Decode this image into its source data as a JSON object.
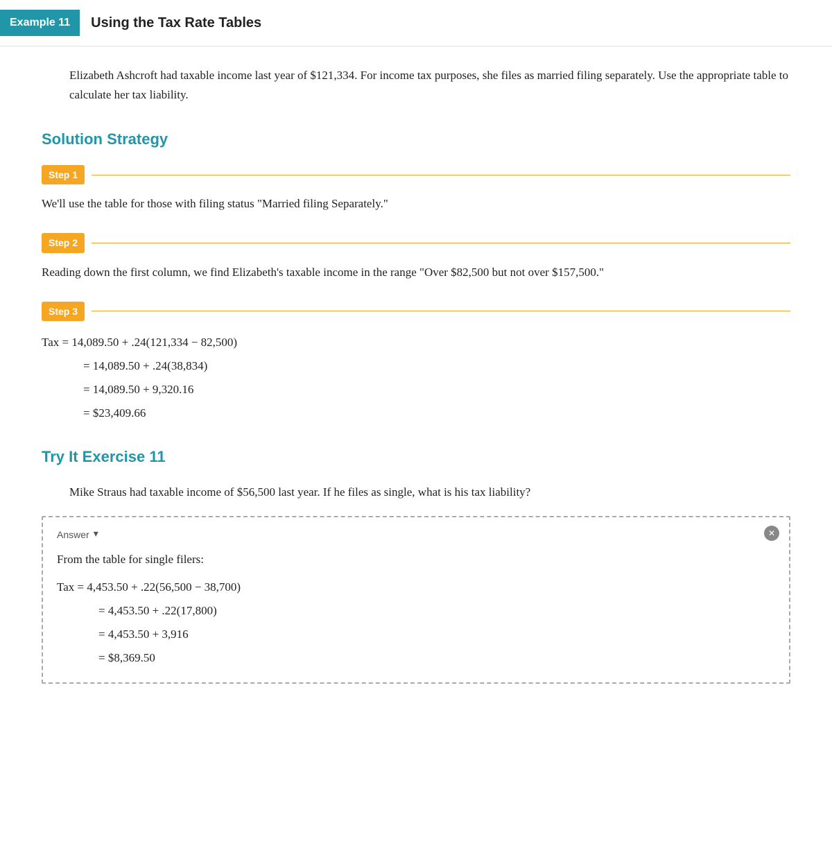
{
  "example": {
    "badge": "Example 11",
    "title": "Using the Tax Rate Tables",
    "problem_text": "Elizabeth Ashcroft had taxable income last year of $121,334. For income tax purposes, she files as married filing separately. Use the appropriate table to calculate her tax liability."
  },
  "solution": {
    "heading": "Solution Strategy",
    "steps": [
      {
        "label": "Step 1",
        "content": "We'll use the table for those with filing status \"Married filing Separately.\""
      },
      {
        "label": "Step 2",
        "content": "Reading down the first column, we find Elizabeth's taxable income in the range \"Over $82,500 but not over $157,500.\""
      },
      {
        "label": "Step 3",
        "content": ""
      }
    ],
    "math_lines": [
      "Tax = 14,089.50 + .24(121,334 − 82,500)",
      "= 14,089.50 + .24(38,834)",
      "= 14,089.50 + 9,320.16",
      "= $23,409.66"
    ]
  },
  "try_it": {
    "heading": "Try It Exercise 11",
    "problem_text": "Mike Straus had taxable income of $56,500 last year. If he files as single, what is his tax liability?",
    "answer": {
      "label": "Answer",
      "intro": "From the table for single filers:",
      "math_lines": [
        "Tax = 4,453.50 + .22(56,500 − 38,700)",
        "= 4,453.50 + .22(17,800)",
        "= 4,453.50 + 3,916",
        "= $8,369.50"
      ]
    }
  }
}
